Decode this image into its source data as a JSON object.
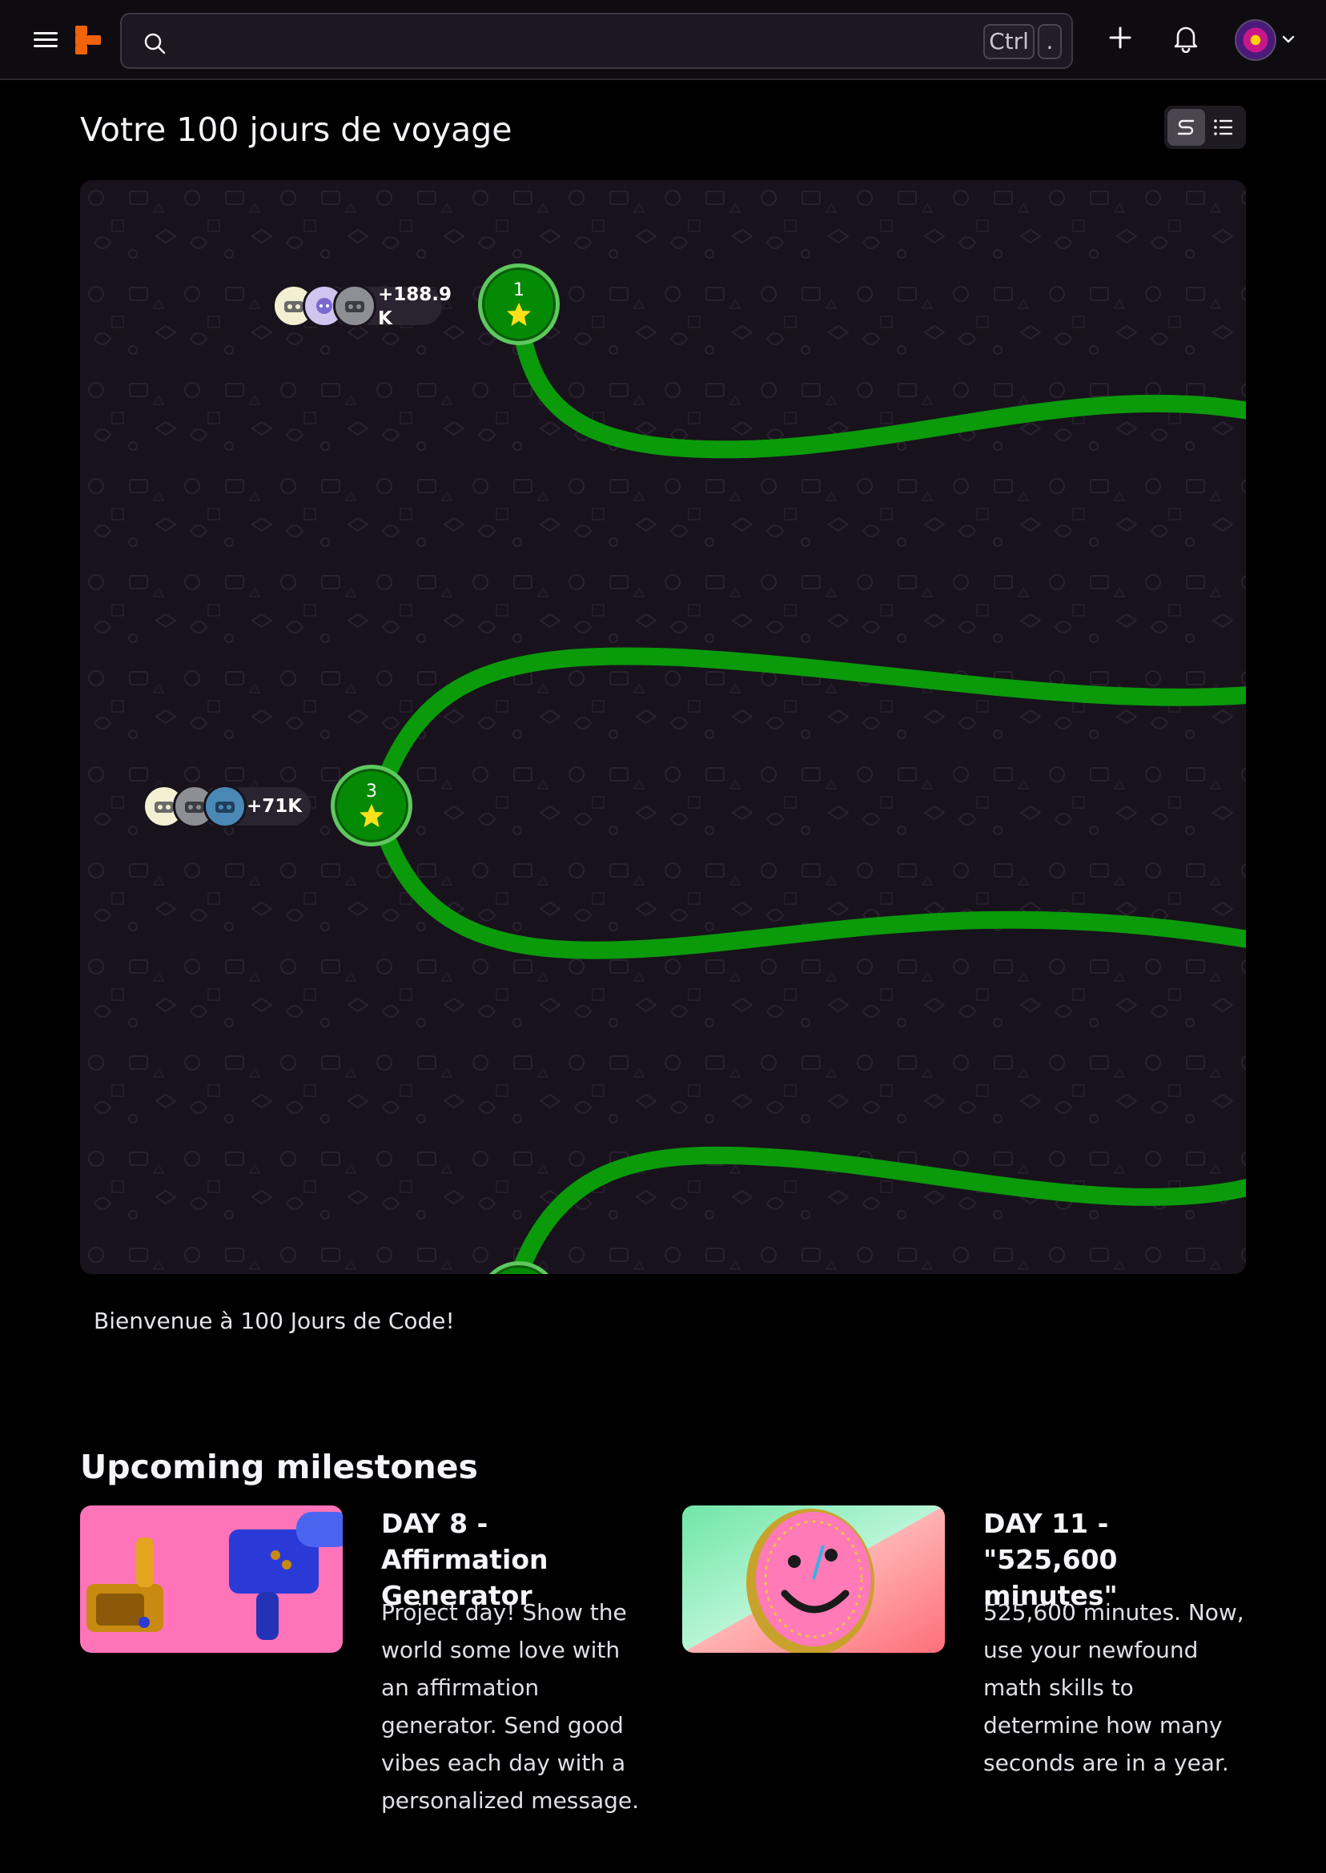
{
  "header": {
    "search": {
      "placeholder": "",
      "shortcut_keys": [
        "Ctrl",
        "."
      ]
    },
    "icons": [
      "menu-icon",
      "replit-logo",
      "search-icon",
      "plus-icon",
      "bell-icon",
      "avatar",
      "chevron-down-icon"
    ]
  },
  "page": {
    "title": "Votre 100 jours de voyage",
    "view_toggle": {
      "options": [
        "path-view",
        "list-view"
      ],
      "selected": "path-view"
    }
  },
  "journey": {
    "nodes": [
      {
        "day": "1",
        "completed": true
      },
      {
        "day": "3",
        "completed": true
      }
    ],
    "participants": [
      {
        "count": "+188.9 K"
      },
      {
        "count": "+71K"
      }
    ],
    "path_color": "#0a9a0a",
    "welcome": "Bienvenue à 100 Jours de Code!"
  },
  "milestones": {
    "heading": "Upcoming milestones",
    "items": [
      {
        "title": "DAY 8 - Affirmation Generator",
        "description": "Project day! Show the world some love with an affirmation generator. Send good vibes each day with a personalized message."
      },
      {
        "title": "DAY 11 - \"525,600 minutes\"",
        "description": "525,600 minutes. Now, use your newfound math skills to determine how many seconds are in a year."
      }
    ]
  },
  "colors": {
    "background": "#000000",
    "panel": "#18121c",
    "accent_orange": "#f26207",
    "node_green": "#058a05"
  }
}
